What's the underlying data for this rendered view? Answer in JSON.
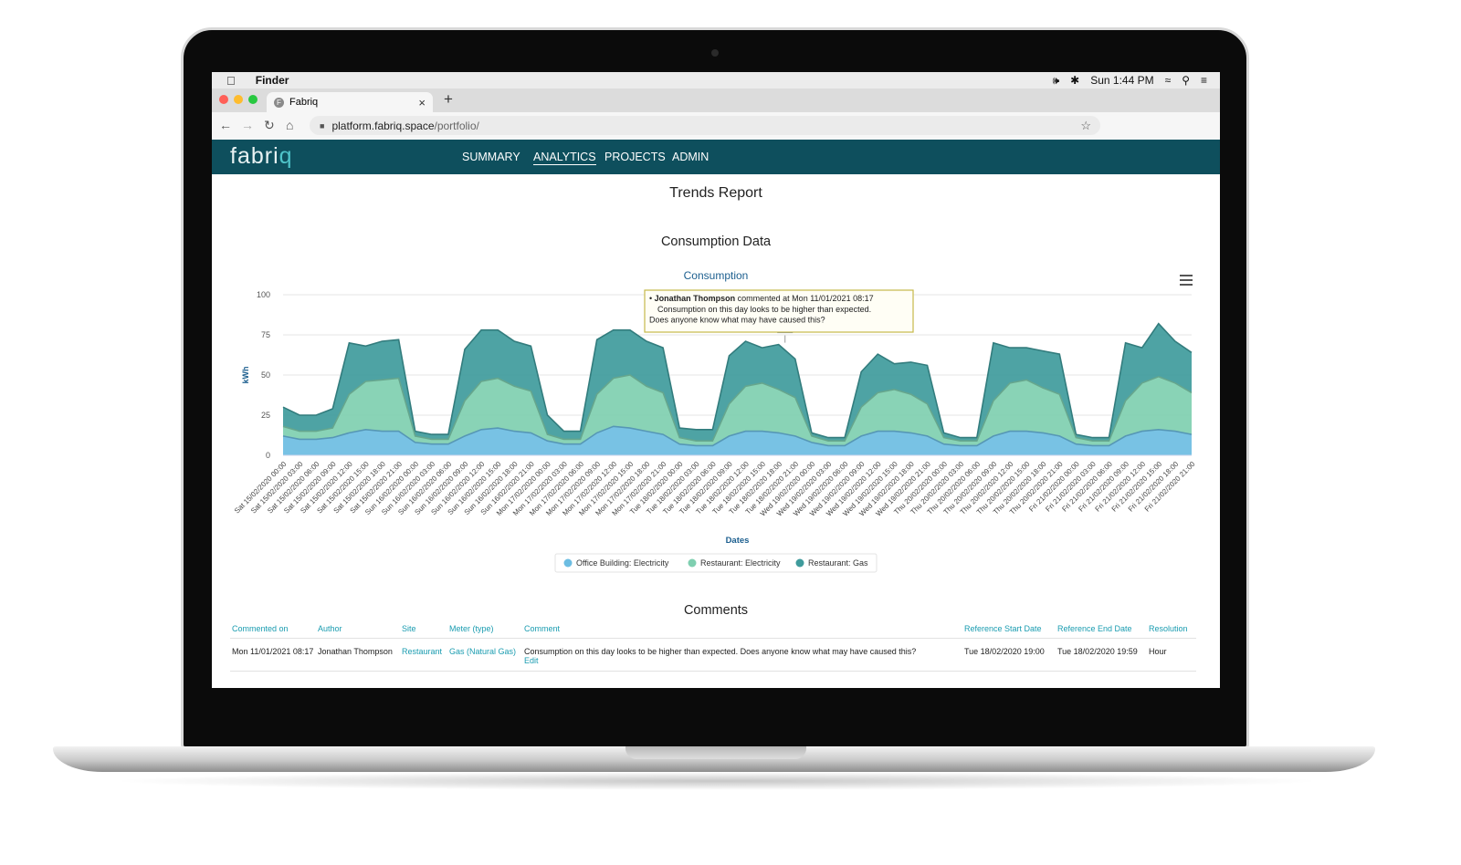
{
  "mac_menubar": {
    "app": "Finder",
    "clock": "Sun 1:44 PM"
  },
  "browser": {
    "tab_title": "Fabriq",
    "url_host": "platform.fabriq.space",
    "url_path": "/portfolio/"
  },
  "app": {
    "logo": "fabri",
    "logo_accent": "q",
    "nav": [
      "SUMMARY",
      "ANALYTICS",
      "PROJECTS",
      "ADMIN"
    ],
    "active_nav": "ANALYTICS",
    "page_title": "Trends Report",
    "section_title": "Consumption Data"
  },
  "chart_data": {
    "type": "area",
    "stacked": true,
    "title": "Consumption",
    "xlabel": "Dates",
    "ylabel": "kWh",
    "ylim": [
      0,
      100
    ],
    "yticks": [
      0,
      25,
      50,
      75,
      100
    ],
    "grid": true,
    "legend_position": "bottom",
    "x": [
      "Sat 15/02/2020 00:00",
      "Sat 15/02/2020 03:00",
      "Sat 15/02/2020 06:00",
      "Sat 15/02/2020 09:00",
      "Sat 15/02/2020 12:00",
      "Sat 15/02/2020 15:00",
      "Sat 15/02/2020 18:00",
      "Sat 15/02/2020 21:00",
      "Sun 16/02/2020 00:00",
      "Sun 16/02/2020 03:00",
      "Sun 16/02/2020 06:00",
      "Sun 16/02/2020 09:00",
      "Sun 16/02/2020 12:00",
      "Sun 16/02/2020 15:00",
      "Sun 16/02/2020 18:00",
      "Sun 16/02/2020 21:00",
      "Mon 17/02/2020 00:00",
      "Mon 17/02/2020 03:00",
      "Mon 17/02/2020 06:00",
      "Mon 17/02/2020 09:00",
      "Mon 17/02/2020 12:00",
      "Mon 17/02/2020 15:00",
      "Mon 17/02/2020 18:00",
      "Mon 17/02/2020 21:00",
      "Tue 18/02/2020 00:00",
      "Tue 18/02/2020 03:00",
      "Tue 18/02/2020 06:00",
      "Tue 18/02/2020 09:00",
      "Tue 18/02/2020 12:00",
      "Tue 18/02/2020 15:00",
      "Tue 18/02/2020 18:00",
      "Tue 18/02/2020 21:00",
      "Wed 19/02/2020 00:00",
      "Wed 19/02/2020 03:00",
      "Wed 19/02/2020 06:00",
      "Wed 19/02/2020 09:00",
      "Wed 19/02/2020 12:00",
      "Wed 19/02/2020 15:00",
      "Wed 19/02/2020 18:00",
      "Wed 19/02/2020 21:00",
      "Thu 20/02/2020 00:00",
      "Thu 20/02/2020 03:00",
      "Thu 20/02/2020 06:00",
      "Thu 20/02/2020 09:00",
      "Thu 20/02/2020 12:00",
      "Thu 20/02/2020 15:00",
      "Thu 20/02/2020 18:00",
      "Thu 20/02/2020 21:00",
      "Fri 21/02/2020 00:00",
      "Fri 21/02/2020 03:00",
      "Fri 21/02/2020 06:00",
      "Fri 21/02/2020 09:00",
      "Fri 21/02/2020 12:00",
      "Fri 21/02/2020 15:00",
      "Fri 21/02/2020 18:00",
      "Fri 21/02/2020 21:00"
    ],
    "series": [
      {
        "name": "Office Building: Electricity",
        "color": "#6cbde2",
        "values": [
          12,
          10,
          10,
          11,
          14,
          16,
          15,
          15,
          8,
          7,
          7,
          12,
          16,
          17,
          15,
          14,
          9,
          7,
          7,
          14,
          18,
          17,
          15,
          13,
          7,
          6,
          6,
          12,
          15,
          15,
          14,
          12,
          8,
          6,
          6,
          12,
          15,
          15,
          14,
          12,
          7,
          6,
          6,
          12,
          15,
          15,
          14,
          12,
          7,
          6,
          6,
          12,
          15,
          16,
          15,
          13
        ]
      },
      {
        "name": "Restaurant: Electricity",
        "color": "#7fcfb0",
        "values": [
          6,
          5,
          5,
          6,
          24,
          30,
          32,
          33,
          4,
          3,
          3,
          22,
          30,
          31,
          28,
          26,
          4,
          3,
          3,
          24,
          30,
          33,
          28,
          26,
          4,
          3,
          3,
          20,
          28,
          30,
          27,
          24,
          4,
          3,
          3,
          18,
          24,
          26,
          24,
          20,
          4,
          3,
          3,
          22,
          30,
          32,
          28,
          26,
          4,
          3,
          3,
          22,
          30,
          33,
          30,
          26
        ]
      },
      {
        "name": "Restaurant: Gas",
        "color": "#3f9b9c",
        "values": [
          12,
          10,
          10,
          12,
          32,
          22,
          24,
          24,
          3,
          3,
          3,
          32,
          32,
          30,
          28,
          28,
          12,
          5,
          5,
          34,
          30,
          28,
          28,
          28,
          6,
          7,
          7,
          30,
          28,
          22,
          28,
          24,
          2,
          2,
          2,
          22,
          24,
          16,
          20,
          24,
          3,
          2,
          2,
          36,
          22,
          20,
          23,
          25,
          2,
          2,
          2,
          36,
          22,
          33,
          26,
          25
        ]
      }
    ],
    "annotation": {
      "marker": "C",
      "x": "Tue 18/02/2020 19:00",
      "author": "Jonathan Thompson",
      "date_text": "commented at Mon 11/01/2021 08:17",
      "lines": [
        "Consumption on this day looks to be higher than expected.",
        "Does anyone know what may have caused this?"
      ]
    }
  },
  "comments": {
    "title": "Comments",
    "headers": [
      "Commented on",
      "Author",
      "Site",
      "Meter (type)",
      "Comment",
      "Reference Start Date",
      "Reference End Date",
      "Resolution"
    ],
    "rows": [
      {
        "commented_on": "Mon 11/01/2021 08:17",
        "author": "Jonathan Thompson",
        "site": "Restaurant",
        "meter": "Gas (Natural Gas)",
        "comment": "Consumption on this day looks to be higher than expected. Does anyone know what may have caused this?",
        "edit": "Edit",
        "ref_start": "Tue 18/02/2020 19:00",
        "ref_end": "Tue 18/02/2020 19:59",
        "resolution": "Hour"
      }
    ]
  }
}
